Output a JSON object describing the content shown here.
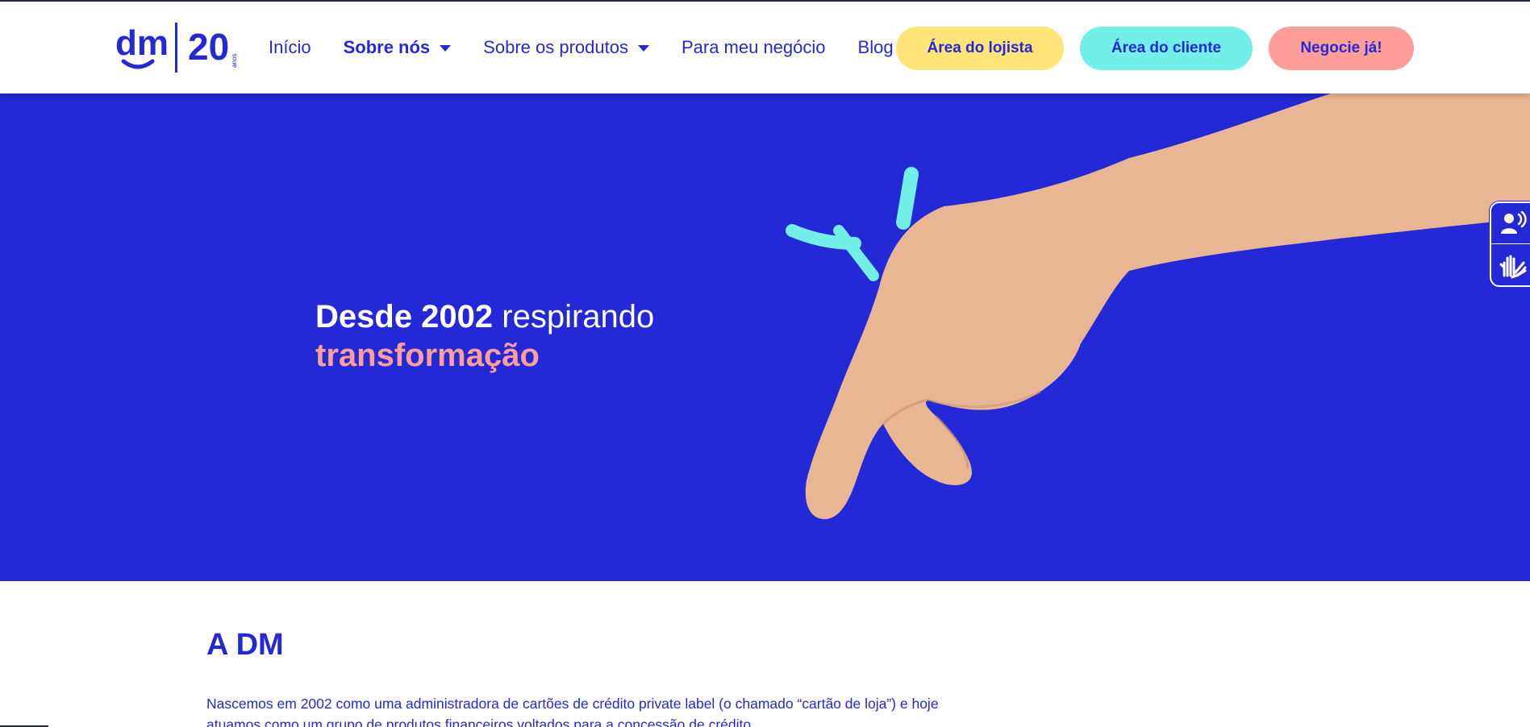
{
  "brand": {
    "logo_text": "dm",
    "anniversary_number": "20",
    "anniversary_word": "anos"
  },
  "nav": {
    "items": [
      {
        "label": "Início",
        "active": false,
        "dropdown": false
      },
      {
        "label": "Sobre nós",
        "active": true,
        "dropdown": true
      },
      {
        "label": "Sobre os produtos",
        "active": false,
        "dropdown": true
      },
      {
        "label": "Para meu negócio",
        "active": false,
        "dropdown": false
      },
      {
        "label": "Blog",
        "active": false,
        "dropdown": false
      }
    ]
  },
  "actions": {
    "lojista": "Área do lojista",
    "cliente": "Área do cliente",
    "negocie": "Negocie já!"
  },
  "hero": {
    "line1_bold": "Desde 2002",
    "line1_rest": " respirando",
    "line2": "transformação"
  },
  "accessibility": {
    "audio_icon": "speaking-person-icon",
    "sign_language_icon": "sign-language-hands-icon"
  },
  "about": {
    "title": "A DM",
    "paragraph": "Nascemos em 2002 como uma administradora de cartões de crédito private label (o chamado “cartão de loja”) e hoje atuamos como um grupo de produtos financeiros voltados para a concessão de crédito."
  },
  "colors": {
    "brand_blue": "#2329d6",
    "yellow": "#ffe478",
    "cyan": "#72efe8",
    "coral": "#ff9e99"
  }
}
